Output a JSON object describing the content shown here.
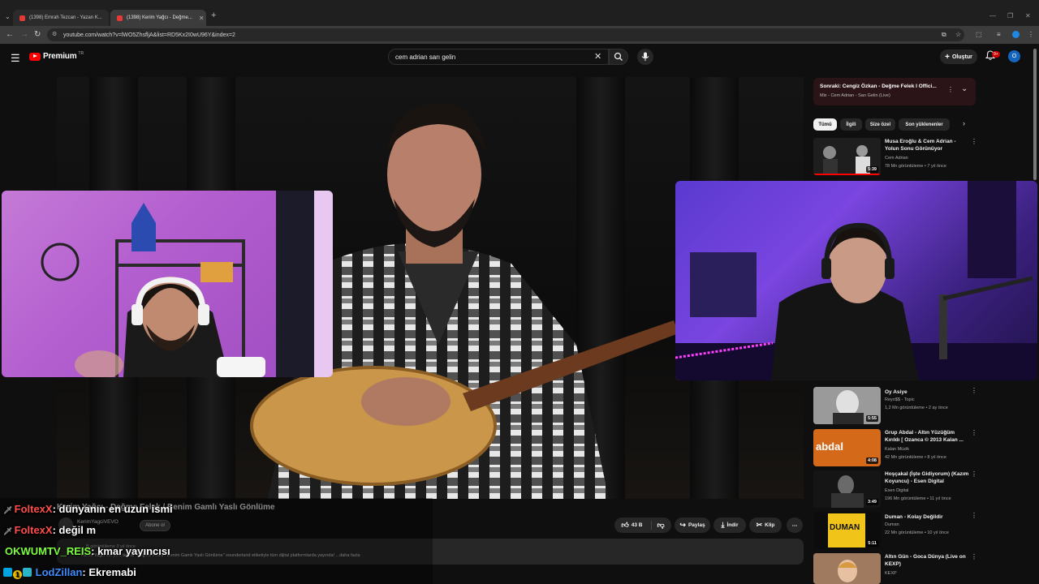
{
  "browser": {
    "tabs": [
      {
        "label": "(1398) Emrah Tezcan - Yazan K..."
      },
      {
        "label": "(1398) Kerim Yağcı - Değme..."
      }
    ],
    "new_tab": "+",
    "url": "youtube.com/watch?v=lWO5ZhsfljA&list=RD5Kx2I0wU96Y&index=2"
  },
  "header": {
    "logo_text": "Premium",
    "logo_region": "TR",
    "search_value": "cem adrian sarı gelin",
    "create_label": "Oluştur",
    "notif_count": "9+",
    "avatar_letter": "O"
  },
  "up_next": {
    "title": "Sonraki: Cengiz Özkan - Değme Felek I Offici...",
    "subtitle": "Mix - Cem Adrian - Sarı Gelin (Live)"
  },
  "chips": [
    "Tümü",
    "İlgili",
    "Size özel",
    "Son yüklenenler"
  ],
  "videos": [
    {
      "title": "Musa Eroğlu & Cem Adrian - Yolun Sonu Görünüyor",
      "channel": "Cem Adrian",
      "meta": "78 Mn görüntüleme • 7 yıl önce",
      "duration": "5:39",
      "thumb_color": "#2a2a2a"
    },
    {
      "title": "Oy Asiye",
      "channel": "Reyo$$ - Topic",
      "meta": "1,2 Mn görüntüleme • 2 ay önce",
      "duration": "5:55",
      "thumb_color": "#8a8a8a"
    },
    {
      "title": "Grup Abdal - Altın Yüzüğüm Kırıldı [ Ozanca © 2013 Kalan ...",
      "channel": "Kalan Müzik",
      "meta": "42 Mn görüntüleme • 8 yıl önce",
      "duration": "4:08",
      "thumb_color": "#d4691a",
      "thumb_text": "abdal"
    },
    {
      "title": "Hoşçakal (İşte Gidiyorum) (Kazım Koyuncu) - Esen Digital",
      "channel": "Esen Digital",
      "meta": "196 Mn görüntüleme • 11 yıl önce",
      "duration": "3:49",
      "thumb_color": "#1a1a1a"
    },
    {
      "title": "Duman - Kolay Değildir",
      "channel": "Duman",
      "meta": "22 Mn görüntüleme • 10 yıl önce",
      "duration": "5:11",
      "thumb_color": "#f0c419",
      "thumb_text": "DUMAN"
    },
    {
      "title": "Altın Gün - Goca Dünya (Live on KEXP)",
      "channel": "KEXP",
      "meta": "",
      "duration": "",
      "thumb_color": "#b58a6a"
    }
  ],
  "video": {
    "title": "Kerim Yağcı - Değme Felek / Benim Gamlı Yaslı Gönlüme",
    "channel": "KerimYagciVEVO",
    "subscribe": "Abone ol",
    "views": "... B görüntüleme  3 yıl önce",
    "description": "Kerim Yağcı'nın yeni teklisi \"Değme Felek / Benim Gamlı Yaslı Gönlüme\" sounderland etiketiyle tüm dijital platformlarda yayında! ...daha fazla",
    "likes": "43 B",
    "share": "Paylaş",
    "download": "İndir",
    "clip": "Klip"
  },
  "chat": [
    {
      "user": "FoltexX",
      "message": ": dünyanın en uzun ismi",
      "color": "#ff4d4d"
    },
    {
      "user": "FoltexX",
      "message": ": değil m",
      "color": "#ff4d4d"
    },
    {
      "user": "OKWUMTV_REIS",
      "message": ": kmar yayıncısı",
      "color": "#7cff3f"
    },
    {
      "user": "LodZillan",
      "message": ": Ekremabi",
      "color": "#3f8cff"
    }
  ],
  "chat_badge_number": "1"
}
